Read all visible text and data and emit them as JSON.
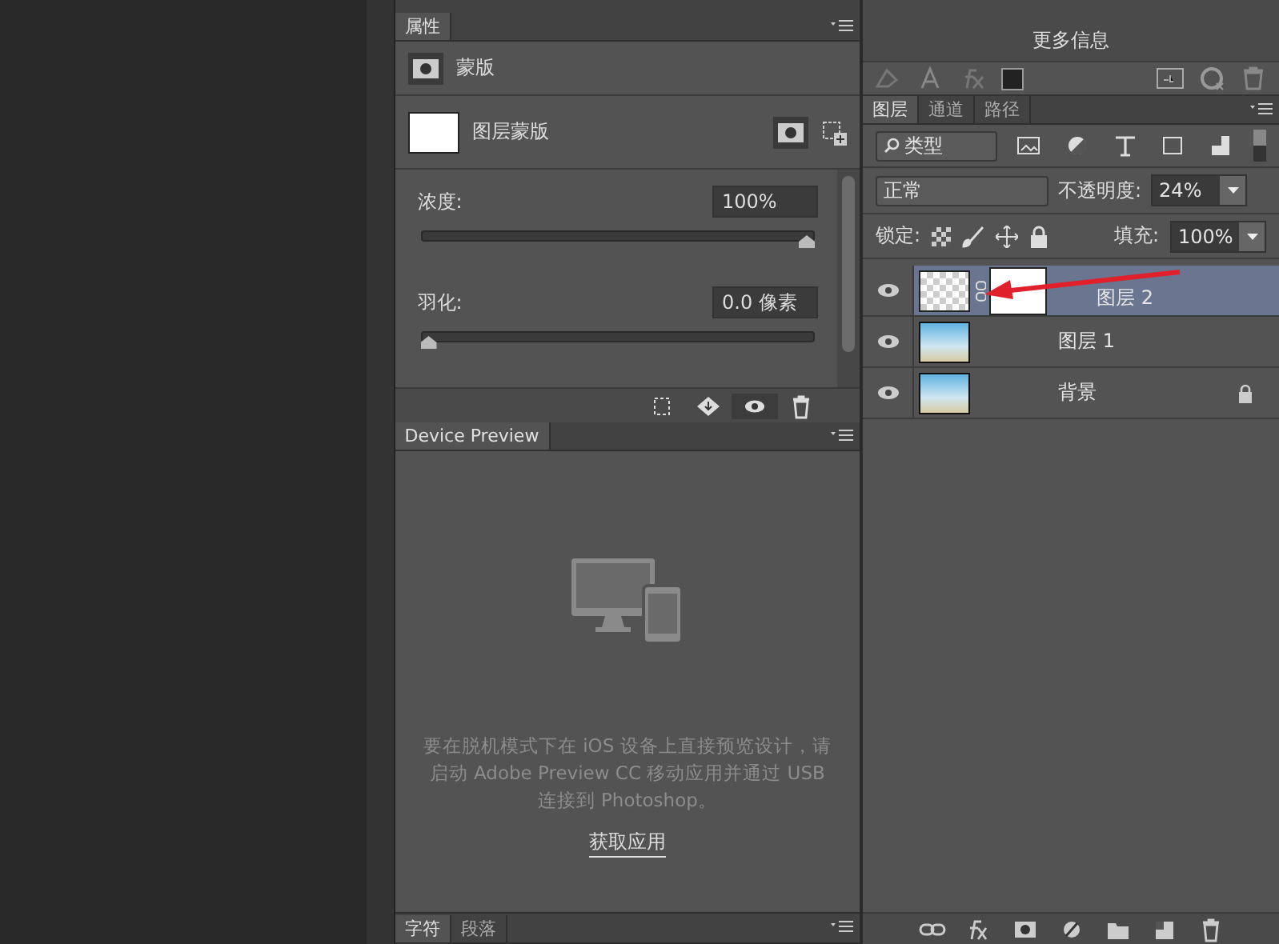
{
  "properties_panel": {
    "tab": "属性",
    "mask_type": "蒙版",
    "mask_label": "图层蒙版",
    "sliders": [
      {
        "label": "浓度:",
        "value": "100%",
        "level": 1
      },
      {
        "label": "羽化:",
        "value": "0.0 像素",
        "level": 0
      }
    ]
  },
  "device_preview": {
    "tab": "Device Preview",
    "message": "要在脱机模式下在 iOS 设备上直接预览设计，请启动 Adobe Preview CC 移动应用并通过 USB 连接到 Photoshop。",
    "link": "获取应用"
  },
  "bottom_tabs": [
    {
      "label": "字符",
      "selected": true
    },
    {
      "label": "段落",
      "selected": false
    }
  ],
  "info_panel": {
    "more_info": "更多信息"
  },
  "layers_panel": {
    "tabs": [
      {
        "label": "图层",
        "selected": true
      },
      {
        "label": "通道",
        "selected": false
      },
      {
        "label": "路径",
        "selected": false
      }
    ],
    "filter": "类型",
    "blend_mode": "正常",
    "opacity_label": "不透明度:",
    "opacity": "24%",
    "lock_label": "锁定:",
    "fill_label": "填充:",
    "fill": "100%",
    "layers": [
      {
        "name": "图层 2",
        "selected": true,
        "kind": "masked",
        "locked": false
      },
      {
        "name": "图层 1",
        "selected": false,
        "kind": "photo",
        "locked": false
      },
      {
        "name": "背景",
        "selected": false,
        "kind": "photo",
        "locked": true
      }
    ]
  }
}
